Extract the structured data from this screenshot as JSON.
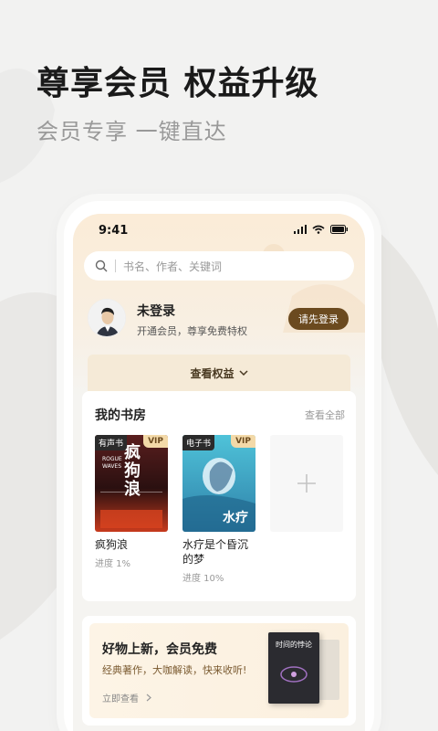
{
  "hero": {
    "title": "尊享会员 权益升级",
    "subtitle": "会员专享 一键直达"
  },
  "status_bar": {
    "time": "9:41"
  },
  "search": {
    "placeholder": "书名、作者、关键词"
  },
  "user": {
    "name": "未登录",
    "desc": "开通会员，尊享免费特权",
    "login_label": "请先登录"
  },
  "benefits": {
    "label": "查看权益"
  },
  "library": {
    "title": "我的书房",
    "view_all": "查看全部",
    "books": [
      {
        "type": "有声书",
        "vip": "VIP",
        "cover_title": "疯狗浪",
        "title": "疯狗浪",
        "progress": "进度 1%"
      },
      {
        "type": "电子书",
        "vip": "VIP",
        "cover_title": "水疗",
        "title": "水疗是个昏沉的梦",
        "progress": "进度 10%"
      }
    ]
  },
  "promo": {
    "title": "好物上新，会员免费",
    "desc": "经典著作，大咖解读，快来收听!",
    "link": "立即查看",
    "cover_title": "时间的悖论"
  },
  "colors": {
    "accent": "#6b4a1f",
    "gold": "#f5ead7"
  }
}
